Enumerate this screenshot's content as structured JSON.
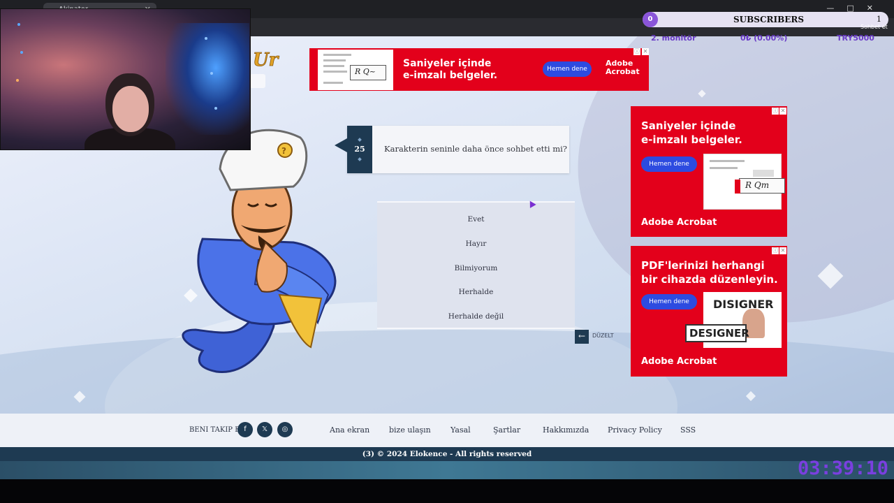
{
  "browser": {
    "tab_title": "Akinator"
  },
  "overlay": {
    "subscribers_label": "SUBSCRIBERS",
    "subscribers_start": "0",
    "subscribers_count": "1",
    "monitor_label": "2. monitör",
    "monitor_value": "0₺ (0.00%)",
    "monitor_code": "TRY5000",
    "chat_label": "Sohbet et",
    "timer": "03:39:10"
  },
  "ads": {
    "banner": {
      "headline_1": "Saniyeler içinde",
      "headline_2": "e-imzalı belgeler.",
      "cta": "Hemen dene",
      "brand_1": "Adobe",
      "brand_2": "Acrobat"
    },
    "side_1": {
      "headline_1": "Saniyeler içinde",
      "headline_2": "e-imzalı belgeler.",
      "cta": "Hemen dene",
      "brand": "Adobe Acrobat"
    },
    "side_2": {
      "headline_1": "PDF'lerinizi herhangi",
      "headline_2": "bir cihazda düzenleyin.",
      "cta": "Hemen dene",
      "brand": "Adobe Acrobat",
      "image_text_1": "DISIGNER",
      "image_text_2": "DESIGNER"
    }
  },
  "question": {
    "number": "25",
    "text": "Karakterin seninle daha önce sohbet etti mi?"
  },
  "answers": [
    "Evet",
    "Hayır",
    "Bilmiyorum",
    "Herhalde",
    "Herhalde değil"
  ],
  "back": {
    "label": "DÜZELT"
  },
  "footer": {
    "follow_label": "BENI TAKIP ET",
    "links": [
      "Ana ekran",
      "bize ulaşın",
      "Yasal",
      "Şartlar",
      "Hakkımızda",
      "Privacy Policy",
      "SSS"
    ],
    "copyright": "(3)  © 2024 Elokence - All rights reserved"
  },
  "colors": {
    "ad_red": "#e3001b",
    "navy": "#1e3a52",
    "accent_purple": "#7a3fe0"
  }
}
